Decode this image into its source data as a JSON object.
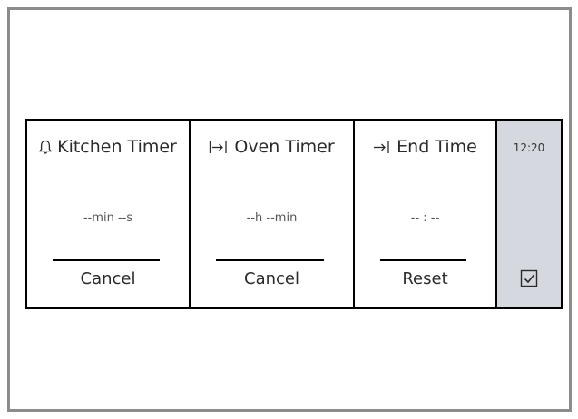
{
  "timers": {
    "kitchen": {
      "icon": "bell-icon",
      "title": "Kitchen Timer",
      "value": "--min --s",
      "action": "Cancel"
    },
    "oven": {
      "icon": "oven-timer-icon",
      "title": "Oven Timer",
      "value": "--h --min",
      "action": "Cancel"
    },
    "end": {
      "icon": "end-time-icon",
      "title": "End Time",
      "value": "-- : --",
      "action": "Reset"
    }
  },
  "side": {
    "clock": "12:20",
    "confirm_icon": "checkbox-check-icon"
  },
  "colors": {
    "border": "#000000",
    "frame": "#8c8c8c",
    "side_panel": "#d5d8de",
    "text": "#2b2b2b"
  }
}
